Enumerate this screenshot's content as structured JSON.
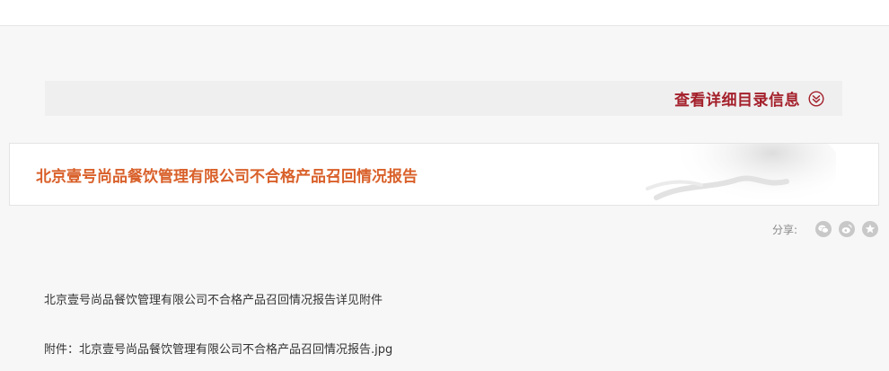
{
  "catalog": {
    "label": "查看详细目录信息",
    "icon": "double-chevron-down-icon",
    "color": "#a4202b"
  },
  "document": {
    "title": "北京壹号尚品餐饮管理有限公司不合格产品召回情况报告",
    "title_color": "#d9602a"
  },
  "share": {
    "label": "分享:",
    "icons": [
      "wechat-icon",
      "weibo-icon",
      "favorite-icon"
    ]
  },
  "body": {
    "paragraph": "北京壹号尚品餐饮管理有限公司不合格产品召回情况报告详见附件",
    "attachment": "附件：北京壹号尚品餐饮管理有限公司不合格产品召回情况报告.jpg"
  }
}
